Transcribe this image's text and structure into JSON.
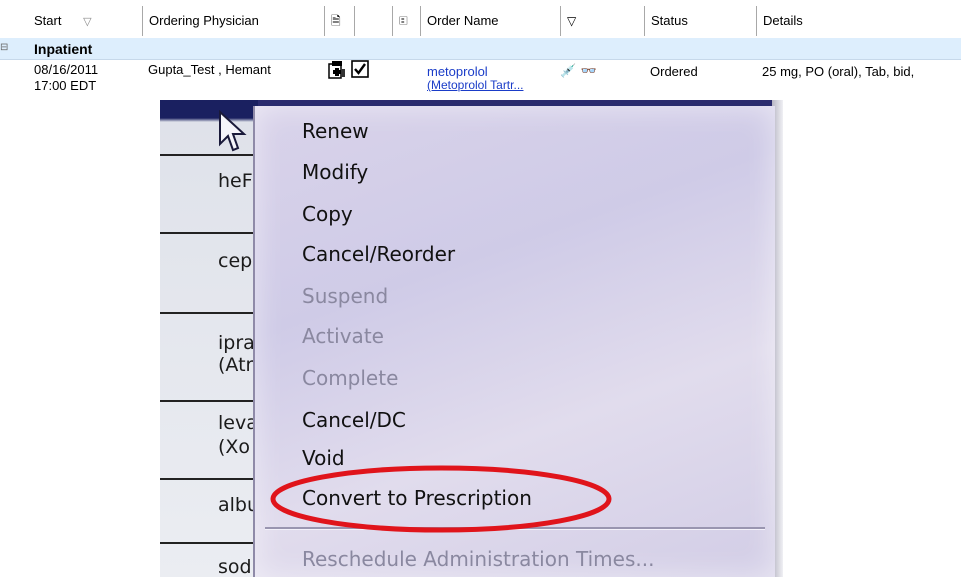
{
  "header": {
    "columns": [
      {
        "label": "Start",
        "sort_icon": "sort-triangle-icon"
      },
      {
        "label": "Ordering Physician"
      },
      {
        "icon": "order-comment-icon"
      },
      {
        "label": ""
      },
      {
        "icon": "note-icon"
      },
      {
        "label": "Order Name"
      },
      {
        "icon": "filter-icon"
      },
      {
        "label": "Status"
      },
      {
        "label": "Details"
      }
    ]
  },
  "group": {
    "label": "Inpatient",
    "toggle_glyph": "⊟"
  },
  "order_row": {
    "start_date": "08/16/2011",
    "start_time": "17:00 EDT",
    "physician": "Gupta_Test , Hemant",
    "order_name_line1": "metoprolol",
    "order_name_line2": "(Metoprolol Tartr...",
    "status": "Ordered",
    "details": "25 mg, PO (oral), Tab, bid,"
  },
  "background_rows": [
    "heF",
    "cep",
    "ipra",
    "(Atr",
    "leva",
    "(Xo",
    "albu",
    "sod"
  ],
  "context_menu": {
    "items": [
      {
        "label": "Renew",
        "enabled": true
      },
      {
        "label": "Modify",
        "enabled": true
      },
      {
        "label": "Copy",
        "enabled": true
      },
      {
        "label": "Cancel/Reorder",
        "enabled": true
      },
      {
        "label": "Suspend",
        "enabled": false
      },
      {
        "label": "Activate",
        "enabled": false
      },
      {
        "label": "Complete",
        "enabled": false
      },
      {
        "label": "Cancel/DC",
        "enabled": true
      },
      {
        "label": "Void",
        "enabled": true
      },
      {
        "label": "Convert to Prescription",
        "enabled": true
      },
      {
        "label": "Reschedule Administration Times...",
        "enabled": false
      }
    ]
  },
  "colors": {
    "group_bg": "#ddeefd",
    "link": "#1a3cc8",
    "highlight": "#e0141b",
    "menu_bg": "#d6d1e9"
  }
}
